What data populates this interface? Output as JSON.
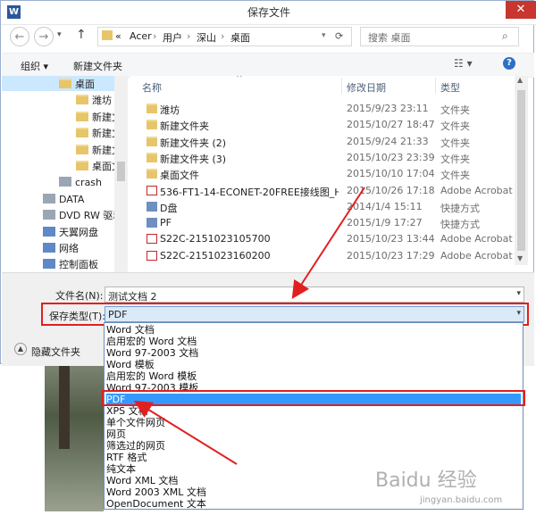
{
  "window": {
    "title": "保存文件",
    "app_icon_letter": "W",
    "close_glyph": "✕"
  },
  "nav": {
    "back_glyph": "←",
    "forward_glyph": "→",
    "up_glyph": "↑",
    "breadcrumb": [
      "«",
      "Acer",
      "›",
      "用户",
      "›",
      "深山",
      "›",
      "桌面"
    ],
    "refresh_glyph": "⟳",
    "search_placeholder": "搜索 桌面"
  },
  "toolbar": {
    "organize": "组织 ▾",
    "new_folder": "新建文件夹",
    "help_glyph": "?"
  },
  "sidebar": {
    "items": [
      {
        "label": "桌面",
        "icon": "folder",
        "indent": 1,
        "selected": true
      },
      {
        "label": "潍坊",
        "icon": "folder",
        "indent": 2
      },
      {
        "label": "新建文",
        "icon": "folder",
        "indent": 2
      },
      {
        "label": "新建文",
        "icon": "folder",
        "indent": 2
      },
      {
        "label": "新建文",
        "icon": "folder",
        "indent": 2
      },
      {
        "label": "桌面文",
        "icon": "folder",
        "indent": 2
      },
      {
        "label": "crash",
        "icon": "drive",
        "indent": 1
      },
      {
        "label": "DATA",
        "icon": "drive",
        "indent": 0
      },
      {
        "label": "DVD RW 驱动",
        "icon": "drive",
        "indent": 0
      },
      {
        "label": "天翼网盘",
        "icon": "network",
        "indent": 0
      },
      {
        "label": "网络",
        "icon": "network",
        "indent": 0
      },
      {
        "label": "控制面板",
        "icon": "network",
        "indent": 0
      }
    ]
  },
  "filelist": {
    "columns": {
      "name": "名称",
      "date": "修改日期",
      "type": "类型"
    },
    "rows": [
      {
        "name": "潍坊",
        "date": "2015/9/23 23:11",
        "type": "文件夹",
        "icon": "folder"
      },
      {
        "name": "新建文件夹",
        "date": "2015/10/27 18:47",
        "type": "文件夹",
        "icon": "folder"
      },
      {
        "name": "新建文件夹 (2)",
        "date": "2015/9/24 21:33",
        "type": "文件夹",
        "icon": "folder"
      },
      {
        "name": "新建文件夹 (3)",
        "date": "2015/10/23 23:39",
        "type": "文件夹",
        "icon": "folder"
      },
      {
        "name": "桌面文件",
        "date": "2015/10/10 17:04",
        "type": "文件夹",
        "icon": "folder"
      },
      {
        "name": "536-FT1-14-ECONET-20FREE接线图_H...",
        "date": "2015/10/26 17:18",
        "type": "Adobe Acrobat",
        "icon": "pdf"
      },
      {
        "name": "D盘",
        "date": "2014/1/4 15:11",
        "type": "快捷方式",
        "icon": "shortcut"
      },
      {
        "name": "PF",
        "date": "2015/1/9 17:27",
        "type": "快捷方式",
        "icon": "shortcut"
      },
      {
        "name": "S22C-2151023105700",
        "date": "2015/10/23 13:44",
        "type": "Adobe Acrobat",
        "icon": "pdf"
      },
      {
        "name": "S22C-2151023160200",
        "date": "2015/10/23 17:29",
        "type": "Adobe Acrobat",
        "icon": "pdf"
      }
    ]
  },
  "form": {
    "filename_label": "文件名(N):",
    "filename_value": "测试文档 2",
    "filetype_label": "保存类型(T):",
    "filetype_value": "PDF",
    "hide_folders": "隐藏文件夹"
  },
  "filetype_options": [
    "Word 文档",
    "启用宏的 Word 文档",
    "Word 97-2003 文档",
    "Word 模板",
    "启用宏的 Word 模板",
    "Word 97-2003 模板",
    "PDF",
    "XPS 文档",
    "单个文件网页",
    "网页",
    "筛选过的网页",
    "RTF 格式",
    "纯文本",
    "Word XML 文档",
    "Word 2003 XML 文档",
    "OpenDocument 文本"
  ],
  "selected_option_index": 6,
  "watermark": {
    "text": "Baidu 经验",
    "url_text": "jingyan.baidu.com"
  },
  "colors": {
    "highlight": "#3399ff",
    "annotation_red": "#e02020",
    "selected_nav": "#cce8ff"
  }
}
